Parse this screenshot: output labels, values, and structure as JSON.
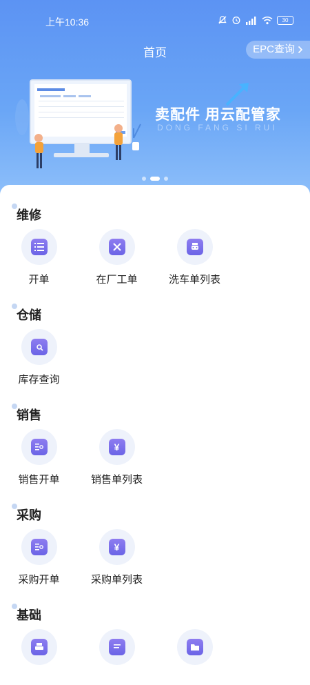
{
  "status_bar": {
    "time": "上午10:36",
    "battery": "30",
    "network": "HD"
  },
  "header": {
    "title": "首页",
    "epc_button": "EPC查询"
  },
  "banner": {
    "slogan": "卖配件 用云配管家",
    "subtitle": "DONG FANG SI RUI",
    "page_count": 3,
    "active_page": 1
  },
  "sections": [
    {
      "title": "维修",
      "items": [
        {
          "label": "开单",
          "icon": "list-icon"
        },
        {
          "label": "在厂工单",
          "icon": "tools-icon"
        },
        {
          "label": "洗车单列表",
          "icon": "car-wash-icon"
        }
      ]
    },
    {
      "title": "仓储",
      "items": [
        {
          "label": "库存查询",
          "icon": "inventory-search-icon"
        }
      ]
    },
    {
      "title": "销售",
      "items": [
        {
          "label": "销售开单",
          "icon": "sales-order-icon"
        },
        {
          "label": "销售单列表",
          "icon": "yen-list-icon"
        }
      ]
    },
    {
      "title": "采购",
      "items": [
        {
          "label": "采购开单",
          "icon": "purchase-order-icon"
        },
        {
          "label": "采购单列表",
          "icon": "yen-list-icon"
        }
      ]
    },
    {
      "title": "基础",
      "items": [
        {
          "label": "",
          "icon": "printer-icon"
        },
        {
          "label": "",
          "icon": "document-icon"
        },
        {
          "label": "",
          "icon": "folder-icon"
        }
      ]
    }
  ]
}
